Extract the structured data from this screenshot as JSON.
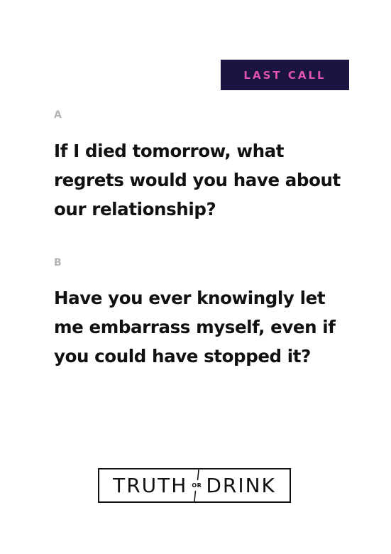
{
  "badge": {
    "label": "LAST CALL"
  },
  "options": [
    {
      "letter": "A",
      "question": "If I died tomorrow, what regrets would you have about our relationship?"
    },
    {
      "letter": "B",
      "question": "Have you ever knowingly let me embarrass myself, even if you could have stopped it?"
    }
  ],
  "logo": {
    "left_word": "TRUTH",
    "connector": "OR",
    "right_word": "DRINK"
  },
  "colors": {
    "background": "#ffffff",
    "badge_background": "#1b1440",
    "badge_text": "#e052b3",
    "option_letter": "#b4b4b4",
    "question_text": "#111111"
  }
}
